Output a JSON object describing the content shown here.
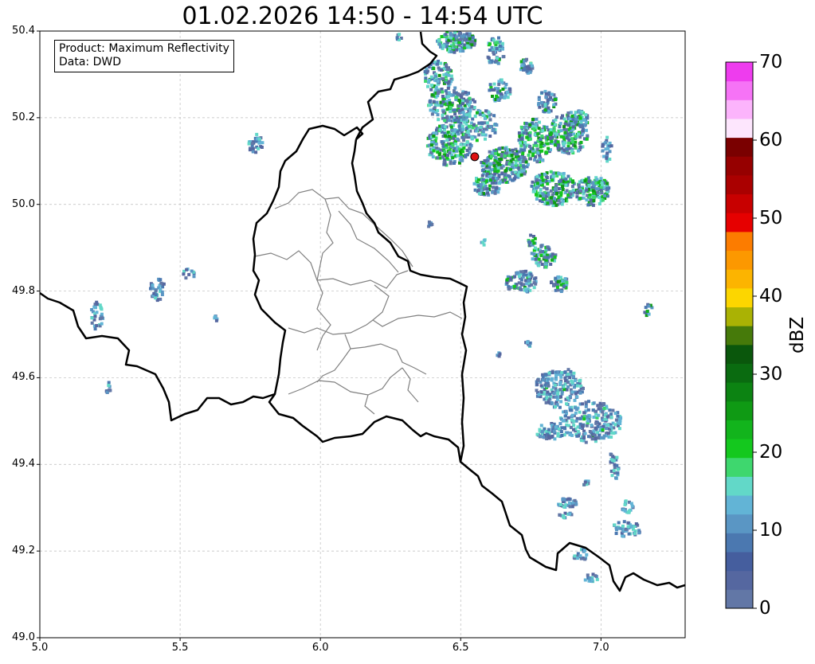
{
  "title": "01.02.2026 14:50 - 14:54 UTC",
  "info": {
    "product": "Product: Maximum Reflectivity",
    "source": "Data: DWD"
  },
  "map": {
    "lon_range": [
      5.0,
      7.3
    ],
    "lat_range": [
      49.0,
      50.4
    ],
    "x_ticks": [
      "5.0",
      "5.5",
      "6.0",
      "6.5",
      "7.0"
    ],
    "y_ticks": [
      "49.0",
      "49.2",
      "49.4",
      "49.6",
      "49.8",
      "50.0",
      "50.2",
      "50.4"
    ],
    "gridlines": true,
    "marker": {
      "lon": 6.55,
      "lat": 50.11,
      "color": "#dd1111"
    }
  },
  "colorbar": {
    "unit": "dBZ",
    "range": [
      0,
      70
    ],
    "tick_labels": [
      "0",
      "10",
      "20",
      "30",
      "40",
      "50",
      "60",
      "70"
    ],
    "colors": [
      "#6277a6",
      "#5567a0",
      "#455e9e",
      "#4b78b0",
      "#5a96c4",
      "#62b4d6",
      "#62d8c8",
      "#3ed76e",
      "#14c81e",
      "#12b41c",
      "#0f9a14",
      "#0c8312",
      "#0a6b10",
      "#0a570c",
      "#467a0a",
      "#aab204",
      "#fcd600",
      "#fcb400",
      "#fc9800",
      "#fc7c00",
      "#e60000",
      "#c80000",
      "#aa0000",
      "#960000",
      "#7a0000",
      "#fde6fd",
      "#fcb4fc",
      "#f673f6",
      "#ee3cee"
    ]
  }
}
